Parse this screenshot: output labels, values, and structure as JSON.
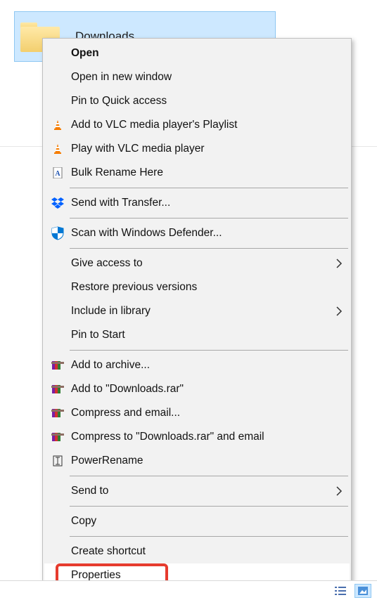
{
  "folder": {
    "name": "Downloads"
  },
  "menu": {
    "open": "Open",
    "open_new_window": "Open in new window",
    "pin_quick_access": "Pin to Quick access",
    "vlc_playlist": "Add to VLC media player's Playlist",
    "vlc_play": "Play with VLC media player",
    "bulk_rename": "Bulk Rename Here",
    "send_transfer": "Send with Transfer...",
    "defender": "Scan with Windows Defender...",
    "give_access": "Give access to",
    "restore_prev": "Restore previous versions",
    "include_library": "Include in library",
    "pin_start": "Pin to Start",
    "add_archive": "Add to archive...",
    "add_downloads_rar": "Add to \"Downloads.rar\"",
    "compress_email": "Compress and email...",
    "compress_downloads_email": "Compress to \"Downloads.rar\" and email",
    "powerrename": "PowerRename",
    "send_to": "Send to",
    "copy": "Copy",
    "create_shortcut": "Create shortcut",
    "properties": "Properties"
  }
}
